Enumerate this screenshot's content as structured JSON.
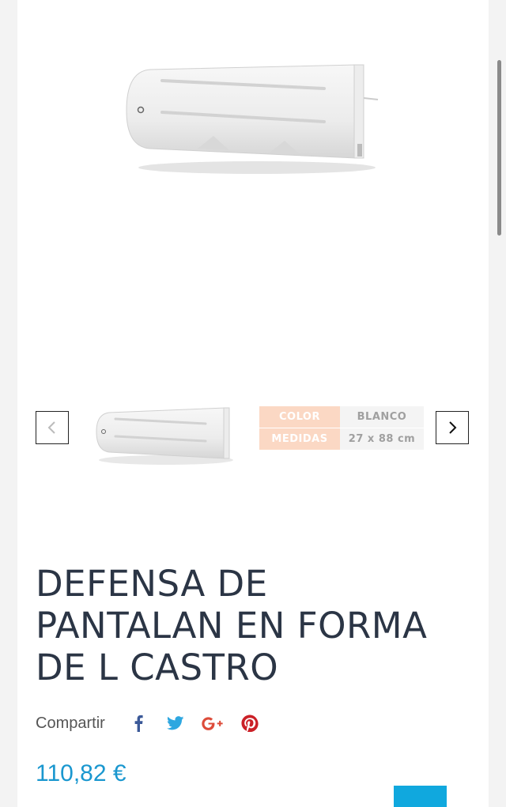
{
  "product": {
    "title_lines": [
      "DEFENSA DE",
      "PANTALAN EN FORMA",
      "DE L CASTRO"
    ],
    "price": "110,82 €",
    "main_image": "white-l-shaped-dock-fender",
    "thumbnail_image": "white-l-shaped-dock-fender"
  },
  "gallery": {
    "prev_icon": "chevron-left-icon",
    "next_icon": "chevron-right-icon",
    "specs": [
      {
        "key": "COLOR",
        "value": "BLANCO"
      },
      {
        "key": "MEDIDAS",
        "value": "27 x 88 cm"
      }
    ]
  },
  "share": {
    "label": "Compartir",
    "networks": [
      {
        "name": "facebook-icon",
        "color": "#3b5998"
      },
      {
        "name": "twitter-icon",
        "color": "#2ea7e0"
      },
      {
        "name": "google-plus-icon",
        "color": "#dd4b39"
      },
      {
        "name": "pinterest-icon",
        "color": "#cb2027"
      }
    ]
  },
  "colors": {
    "accent": "#1a97cf",
    "button": "#10a8de",
    "spec_key_bg": "#fbd8c4"
  }
}
